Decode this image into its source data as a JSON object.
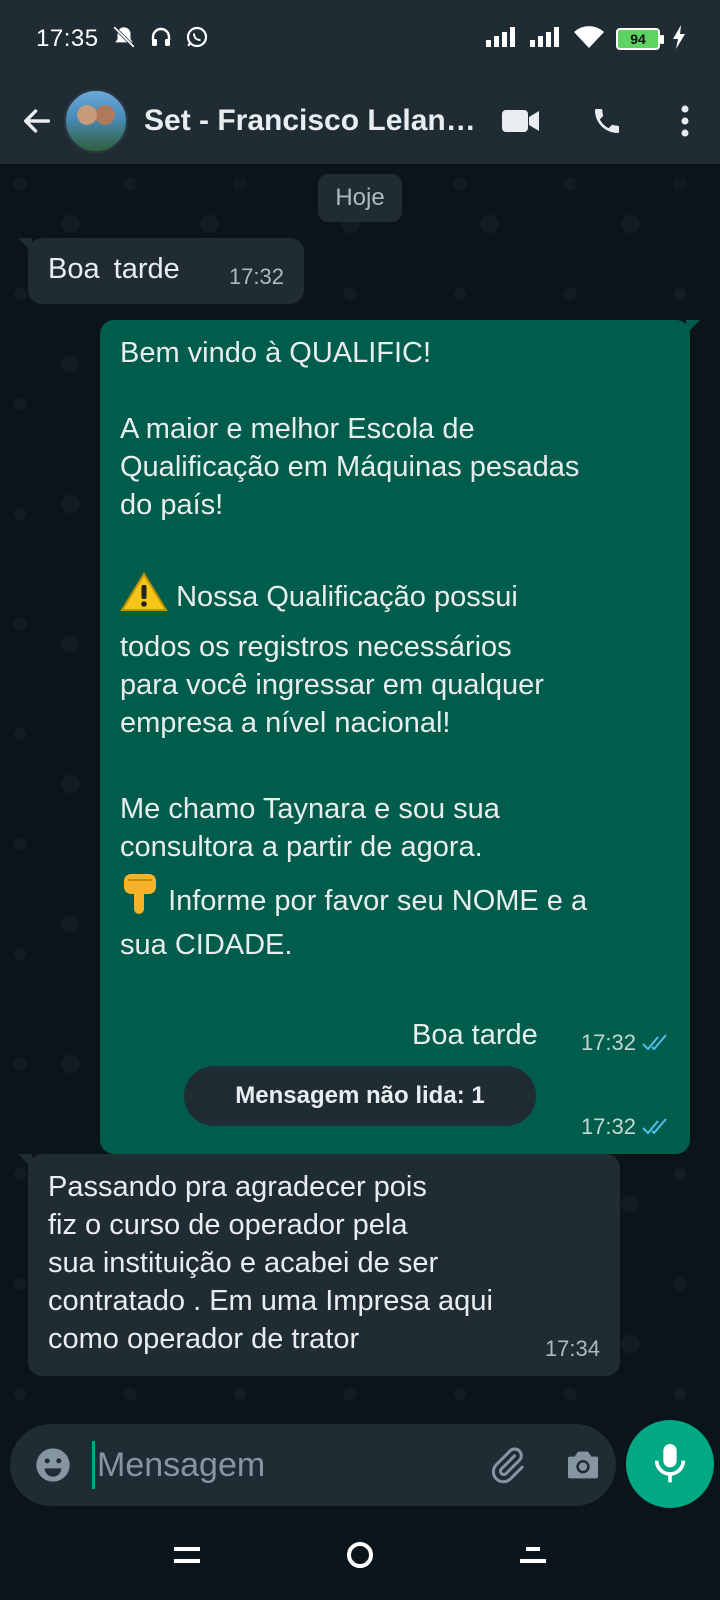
{
  "status_bar": {
    "time": "17:35",
    "battery": "94",
    "left_icons": [
      "mute-icon",
      "headphones-icon",
      "whatsapp-icon"
    ],
    "right_icons": [
      "signal-icon",
      "signal-icon",
      "wifi-icon",
      "battery-icon",
      "charging-icon"
    ]
  },
  "header": {
    "contact_name": "Set - Francisco Lelan…",
    "icons": [
      "back-arrow-icon",
      "video-call-icon",
      "phone-icon",
      "more-options-icon"
    ]
  },
  "chat": {
    "date_chip": "Hoje",
    "messages": [
      {
        "direction": "incoming",
        "text": "Boa  tarde",
        "time": "17:32"
      },
      {
        "direction": "outgoing",
        "lines": {
          "l1": "Bem vindo à QUALIFIC!",
          "l2": "A maior e melhor Escola de",
          "l3": "Qualificação em Máquinas pesadas",
          "l4": "do país!",
          "l5": "Nossa Qualificação possui",
          "l6": "todos os registros necessários",
          "l7": "para você ingressar em qualquer",
          "l8": "empresa a nível nacional!",
          "l9": "Me chamo Taynara e sou sua",
          "l10": "consultora a partir de agora.",
          "l11": "Informe por favor seu NOME e a",
          "l12": "sua CIDADE."
        },
        "emojis": [
          "warning-emoji",
          "pointing-down-emoji"
        ],
        "time": "17:32",
        "status": "read"
      },
      {
        "direction": "outgoing",
        "text": "Boa tarde",
        "time": "17:32",
        "status": "read"
      },
      {
        "direction": "incoming",
        "text": "Passando pra agradecer pois\nfiz o curso de operador pela\nsua instituição e acabei de ser\ncontratado . Em uma Impresa aqui\ncomo operador de trator",
        "time": "17:34"
      }
    ],
    "unread_label": "Mensagem não lida: 1"
  },
  "input": {
    "placeholder": "Mensagem",
    "value": ""
  },
  "colors": {
    "header_bg": "#1f2c34",
    "chat_bg": "#0b141a",
    "incoming_bubble": "#1f2c34",
    "outgoing_bubble": "#005c4b",
    "accent": "#00a884",
    "read_ticks": "#53bdeb"
  }
}
